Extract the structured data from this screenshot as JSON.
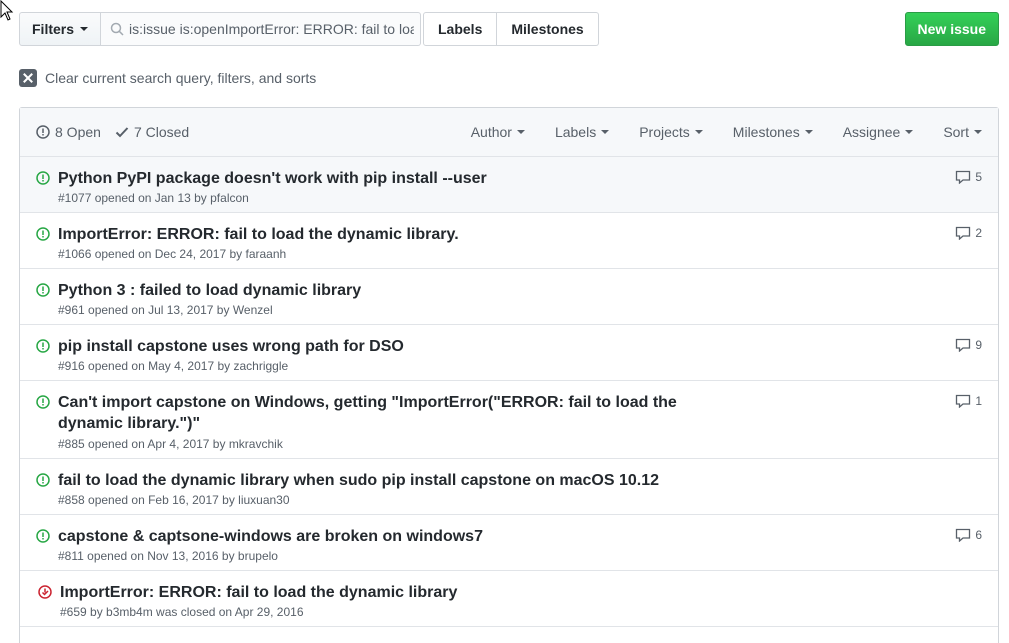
{
  "toolbar": {
    "filters_label": "Filters",
    "search_value": "is:issue is:openImportError: ERROR: fail to load",
    "labels_label": "Labels",
    "milestones_label": "Milestones",
    "new_issue_label": "New issue"
  },
  "clear_filters": "Clear current search query, filters, and sorts",
  "header": {
    "open": "8 Open",
    "closed": "7 Closed",
    "filters": [
      "Author",
      "Labels",
      "Projects",
      "Milestones",
      "Assignee",
      "Sort"
    ]
  },
  "issues": [
    {
      "title": "Python PyPI package doesn't work with pip install --user",
      "meta": "#1077 opened on Jan 13 by pfalcon",
      "comments": "5",
      "state": "open"
    },
    {
      "title": "ImportError: ERROR: fail to load the dynamic library.",
      "meta": "#1066 opened on Dec 24, 2017 by faraanh",
      "comments": "2",
      "state": "open"
    },
    {
      "title": "Python 3 : failed to load dynamic library",
      "meta": "#961 opened on Jul 13, 2017 by Wenzel",
      "comments": "",
      "state": "open"
    },
    {
      "title": "pip install capstone uses wrong path for DSO",
      "meta": "#916 opened on May 4, 2017 by zachriggle",
      "comments": "9",
      "state": "open"
    },
    {
      "title": "Can't import capstone on Windows, getting \"ImportError(\"ERROR: fail to load the dynamic library.\")\"",
      "meta": "#885 opened on Apr 4, 2017 by mkravchik",
      "comments": "1",
      "state": "open"
    },
    {
      "title": "fail to load the dynamic library when sudo pip install capstone on macOS 10.12",
      "meta": "#858 opened on Feb 16, 2017 by liuxuan30",
      "comments": "",
      "state": "open"
    },
    {
      "title": "capstone & captsone-windows are broken on windows7",
      "meta": "#811 opened on Nov 13, 2016 by brupelo",
      "comments": "6",
      "state": "open"
    },
    {
      "title": "ImportError: ERROR: fail to load the dynamic library",
      "meta": "#659 by b3mb4m was closed on Apr 29, 2016",
      "comments": "",
      "state": "closed"
    }
  ],
  "colors": {
    "open": "#28a745",
    "closed": "#cb2431",
    "new_issue": "#28a745"
  }
}
